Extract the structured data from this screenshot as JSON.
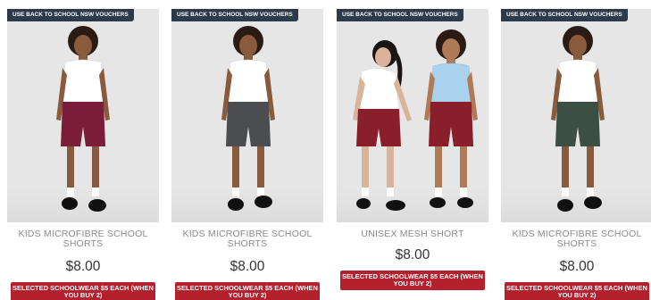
{
  "products": [
    {
      "badge": "USE BACK TO SCHOOL NSW VOUCHERS",
      "title": "KIDS MICROFIBRE SCHOOL SHORTS",
      "price": "$8.00",
      "promo": "SELECTED SCHOOLWEAR $5 EACH (WHEN YOU BUY 2)",
      "shorts_color": "#7a1c3a"
    },
    {
      "badge": "USE BACK TO SCHOOL NSW VOUCHERS",
      "title": "KIDS MICROFIBRE SCHOOL SHORTS",
      "price": "$8.00",
      "promo": "SELECTED SCHOOLWEAR $5 EACH (WHEN YOU BUY 2)",
      "shorts_color": "#4b4d50"
    },
    {
      "badge": "USE BACK TO SCHOOL NSW VOUCHERS",
      "title": "UNISEX MESH SHORT",
      "price": "$8.00",
      "promo": "SELECTED SCHOOLWEAR $5 EACH (WHEN YOU BUY 2)",
      "shorts_color": "#8a1f2c"
    },
    {
      "badge": "USE BACK TO SCHOOL NSW VOUCHERS",
      "title": "KIDS MICROFIBRE SCHOOL SHORTS",
      "price": "$8.00",
      "promo": "SELECTED SCHOOLWEAR $5 EACH (WHEN YOU BUY 2)",
      "shorts_color": "#3c4f45"
    }
  ],
  "colors": {
    "badge_bg": "#2d3a4a",
    "promo_bg": "#b5202e",
    "photo_bg": "#e6e6e6",
    "title_text": "#8a8a8a"
  }
}
